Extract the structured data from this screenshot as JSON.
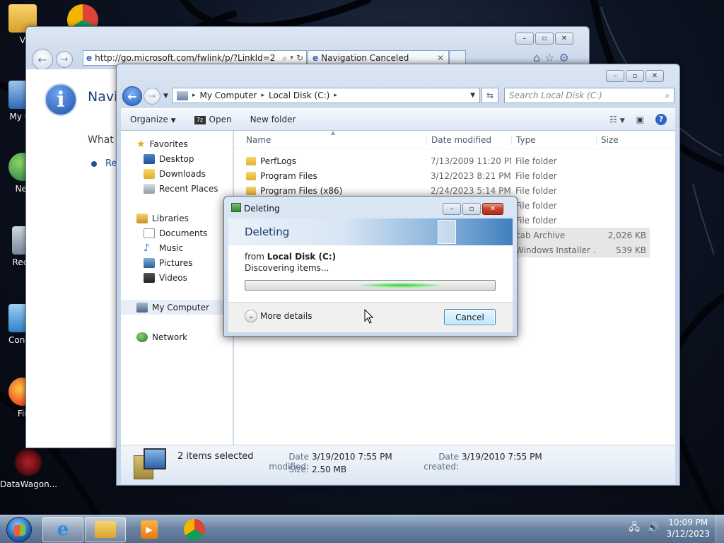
{
  "desktop": {
    "icons": [
      {
        "label": "V",
        "name": "user-folder"
      },
      {
        "label": "My Co",
        "name": "my-computer"
      },
      {
        "label": "Net",
        "name": "network"
      },
      {
        "label": "Recy",
        "name": "recycle-bin"
      },
      {
        "label": "Contro",
        "name": "control-panel"
      },
      {
        "label": "Fir",
        "name": "firefox"
      },
      {
        "label": "DataWagon...",
        "name": "datawagon"
      }
    ]
  },
  "ie": {
    "address": "http://go.microsoft.com/fwlink/p/?LinkId=2",
    "tab_title": "Navigation Canceled",
    "heading": "Navig",
    "text": "What y",
    "bullet": "Re"
  },
  "explorer": {
    "breadcrumb": [
      "My Computer",
      "Local Disk (C:)"
    ],
    "search_placeholder": "Search Local Disk (C:)",
    "toolbar": {
      "organize": "Organize",
      "open": "Open",
      "new_folder": "New folder"
    },
    "nav": {
      "favorites": "Favorites",
      "desktop": "Desktop",
      "downloads": "Downloads",
      "recent_places": "Recent Places",
      "libraries": "Libraries",
      "documents": "Documents",
      "music": "Music",
      "pictures": "Pictures",
      "videos": "Videos",
      "my_computer": "My Computer",
      "network": "Network"
    },
    "columns": {
      "name": "Name",
      "date": "Date modified",
      "type": "Type",
      "size": "Size"
    },
    "rows": [
      {
        "name": "PerfLogs",
        "date": "7/13/2009 11:20 PM",
        "type": "File folder",
        "size": ""
      },
      {
        "name": "Program Files",
        "date": "3/12/2023 8:21 PM",
        "type": "File folder",
        "size": ""
      },
      {
        "name": "Program Files (x86)",
        "date": "2/24/2023 5:14 PM",
        "type": "File folder",
        "size": ""
      },
      {
        "name": "",
        "date": "",
        "type": "File folder",
        "size": ""
      },
      {
        "name": "",
        "date": "",
        "type": "File folder",
        "size": ""
      },
      {
        "name": "",
        "date": "",
        "type": "cab Archive",
        "size": "2,026 KB"
      },
      {
        "name": "",
        "date": "",
        "type": "Windows Installer ...",
        "size": "539 KB"
      }
    ],
    "details": {
      "count": "2 items selected",
      "date_modified_label": "Date modified:",
      "date_modified": "3/19/2010 7:55 PM",
      "date_created_label": "Date created:",
      "date_created": "3/19/2010 7:55 PM",
      "size_label": "Size:",
      "size": "2.50 MB"
    }
  },
  "dialog": {
    "title": "Deleting",
    "banner": "Deleting",
    "from_prefix": "from",
    "from_location": "Local Disk (C:)",
    "status": "Discovering items...",
    "progress_indeterminate": true,
    "more_details": "More details",
    "cancel": "Cancel"
  },
  "taskbar": {
    "time": "10:09 PM",
    "date": "3/12/2023"
  },
  "colors": {
    "accent": "#2a66c4",
    "progress_green": "#2ed33b",
    "close_red": "#c8402a"
  }
}
